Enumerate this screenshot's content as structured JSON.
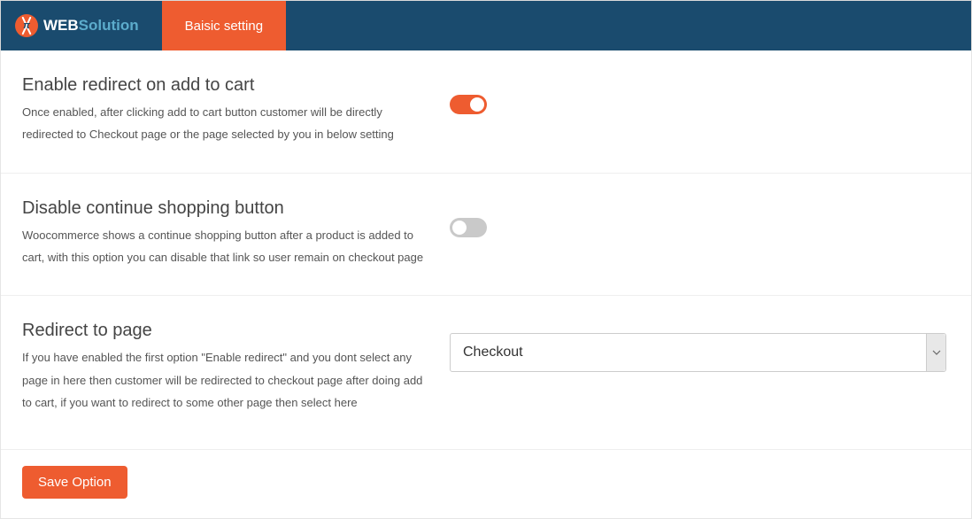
{
  "brand": {
    "web": "WEB",
    "solution": "Solution",
    "pi": "π"
  },
  "tab": {
    "label": "Baisic setting"
  },
  "settings": [
    {
      "title": "Enable redirect on add to cart",
      "desc": "Once enabled, after clicking add to cart button customer will be directly redirected to Checkout page or the page selected by you in below setting",
      "type": "toggle",
      "value": true
    },
    {
      "title": "Disable continue shopping button",
      "desc": "Woocommerce shows a continue shopping button after a product is added to cart, with this option you can disable that link so user remain on checkout page",
      "type": "toggle",
      "value": false
    },
    {
      "title": "Redirect to page",
      "desc": "If you have enabled the first option \"Enable redirect\" and you dont select any page in here then customer will be redirected to checkout page after doing add to cart, if you want to redirect to some other page then select here",
      "type": "select",
      "value": "Checkout"
    }
  ],
  "footer": {
    "save_label": "Save Option"
  }
}
